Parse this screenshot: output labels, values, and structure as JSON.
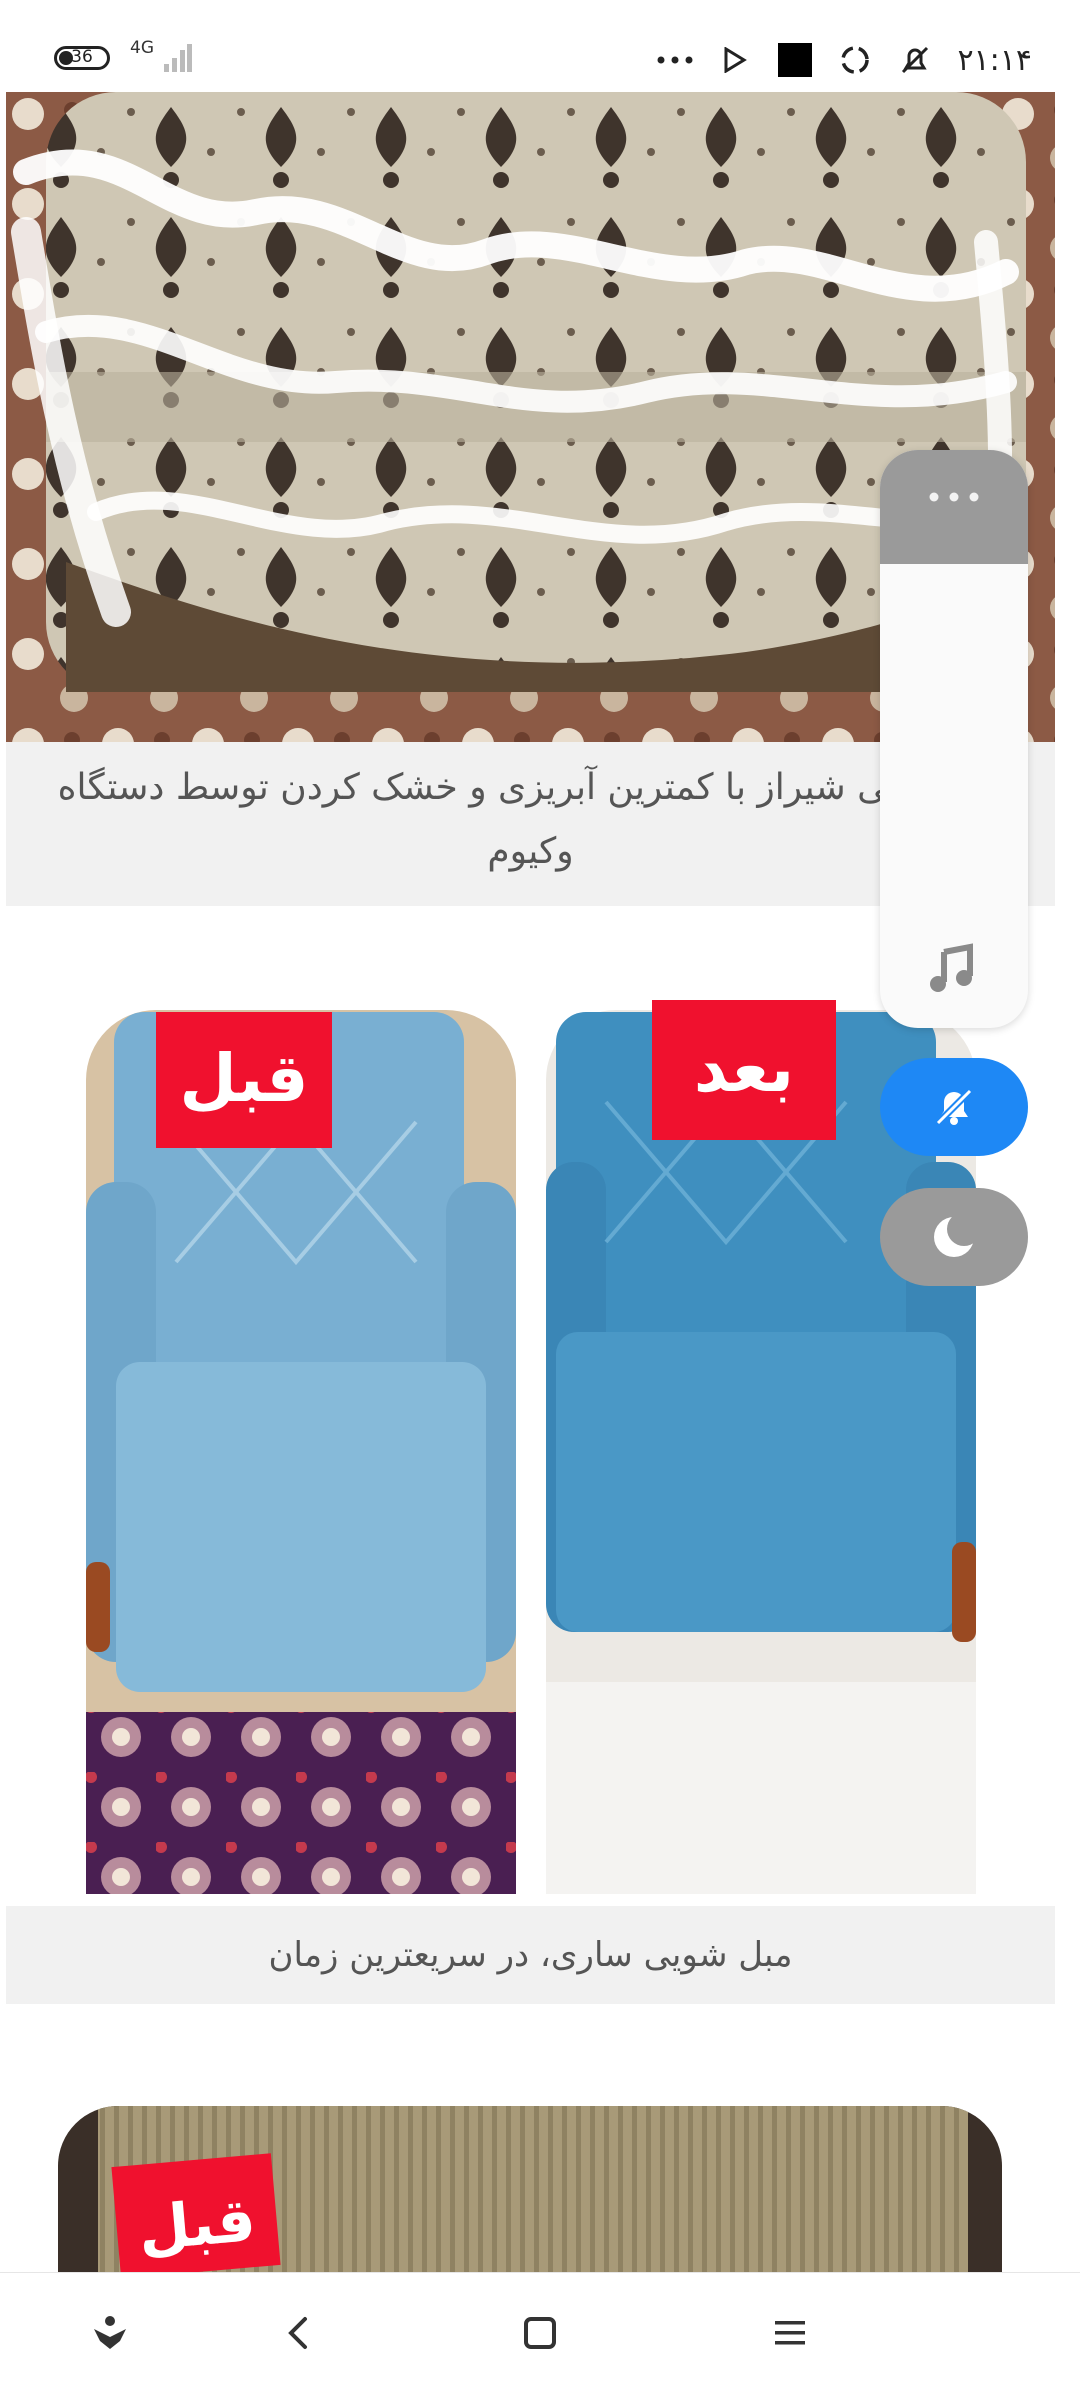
{
  "status_bar": {
    "battery_level": "36",
    "network": "4G",
    "time": "۲۱:۱۴",
    "icons": [
      "more-dots-icon",
      "play-store-icon",
      "square-icon",
      "sync-icon",
      "muted-bell-icon"
    ]
  },
  "posts": [
    {
      "caption_line1": "مبل‌شویی شیراز با کمترین آبریزی و خشک کردن توسط دستگاه",
      "caption_line2": "وکیوم"
    },
    {
      "tag_before": "قبل",
      "tag_after": "بعد",
      "caption": "مبل شویی ساری، در سریعترین زمان"
    },
    {
      "tag_before": "قبل"
    }
  ],
  "floating_panel": {
    "menu_icon": "more-horiz-icon",
    "music_icon": "music-note-icon",
    "mute_icon": "bell-off-icon",
    "night_icon": "moon-icon"
  },
  "navbar": {
    "buttons": [
      "accessibility-icon",
      "back-icon",
      "home-icon",
      "menu-icon"
    ]
  },
  "colors": {
    "tag_red": "#f0112e",
    "mute_blue": "#1e88f5",
    "panel_grey": "#9a9a9a"
  }
}
